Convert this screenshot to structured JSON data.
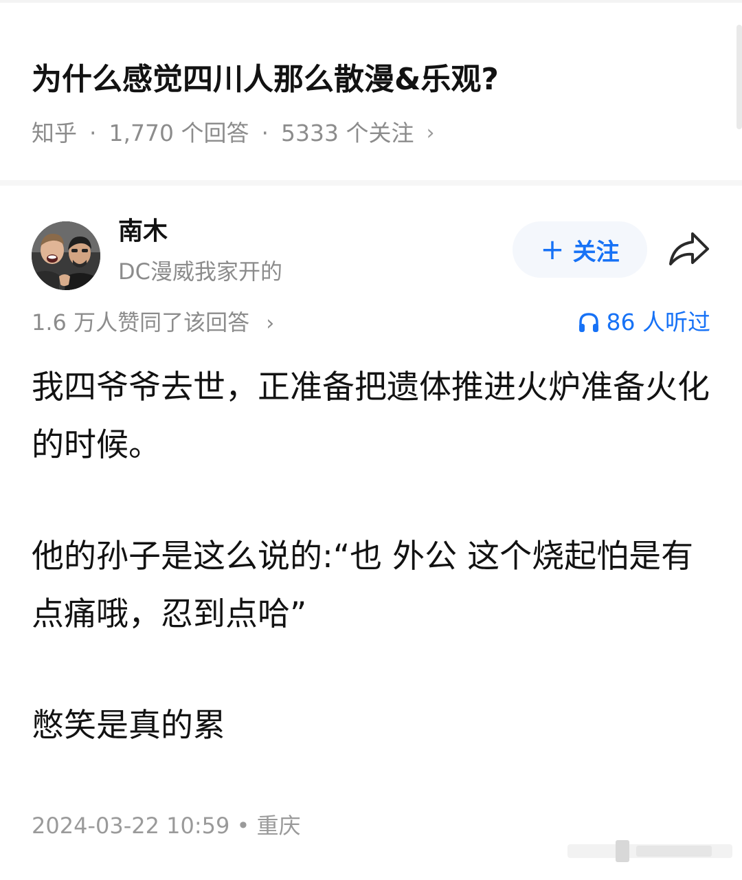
{
  "question": {
    "title": "为什么感觉四川人那么散漫&乐观?",
    "source": "知乎",
    "answers_count": "1,770 个回答",
    "followers": "5333 个关注",
    "separator": "·",
    "chevron": "›"
  },
  "author": {
    "name": "南木",
    "bio": "DC漫威我家开的",
    "follow_label": "关注",
    "follow_plus": "+"
  },
  "answer": {
    "votes": "1.6 万人赞同了该回答",
    "votes_chevron": "›",
    "listens": "86 人听过",
    "paragraphs": [
      "我四爷爷去世，正准备把遗体推进火炉准备火化的时候。",
      "他的孙子是这么说的:“也 外公 这个烧起怕是有点痛哦，忍到点哈”",
      "憋笑是真的累"
    ],
    "date": "2024-03-22 10:59",
    "location_sep": "•",
    "location": "重庆"
  },
  "colors": {
    "accent": "#1772f6",
    "muted": "#8c8c8c",
    "text": "#121212",
    "follow_bg": "#f4f7fc"
  },
  "icons": {
    "share": "share-arrow-icon",
    "headphones": "headphones-icon",
    "chevron": "chevron-right-icon"
  }
}
